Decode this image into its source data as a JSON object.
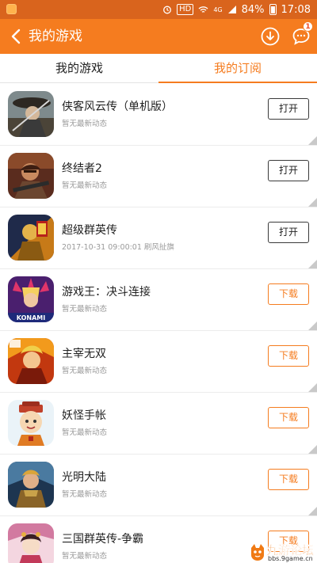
{
  "status_bar": {
    "app_icon": "app-notification-icon",
    "hd": "HD",
    "network": "4G",
    "battery": "84%",
    "time": "17:08"
  },
  "header": {
    "title": "我的游戏",
    "back_icon": "chevron-left-icon",
    "download_icon": "download-circle-icon",
    "message_icon": "message-bubble-icon",
    "message_badge": "1"
  },
  "tabs": [
    {
      "label": "我的游戏",
      "active": false
    },
    {
      "label": "我的订阅",
      "active": true
    }
  ],
  "games": [
    {
      "name": "侠客风云传（单机版）",
      "status": "暂无最新动态",
      "action": "打开"
    },
    {
      "name": "终结者2",
      "status": "暂无最新动态",
      "action": "打开"
    },
    {
      "name": "超级群英传",
      "status": "2017-10-31 09:00:01 刷风扯旗",
      "action": "打开"
    },
    {
      "name": "游戏王：决斗连接",
      "status": "暂无最新动态",
      "action": "下载"
    },
    {
      "name": "主宰无双",
      "status": "暂无最新动态",
      "action": "下载"
    },
    {
      "name": "妖怪手帐",
      "status": "暂无最新动态",
      "action": "下载"
    },
    {
      "name": "光明大陆",
      "status": "暂无最新动态",
      "action": "下载"
    },
    {
      "name": "三国群英传-争霸",
      "status": "暂无最新动态",
      "action": "下载"
    }
  ],
  "icon_texts": {
    "konami": "KONAMI"
  },
  "watermark": {
    "title": "九游论坛",
    "url": "bbs.9game.cn"
  },
  "colors": {
    "accent": "#f57c1f",
    "status_bar": "#d9641d"
  }
}
